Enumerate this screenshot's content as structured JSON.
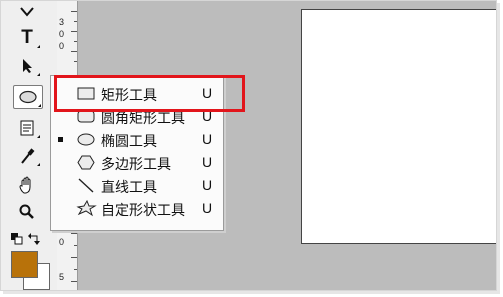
{
  "toolbox": {
    "text_tool_glyph": "T",
    "foreground_color": "#b8720a",
    "background_color": "#ffffff"
  },
  "ruler": {
    "marks_top": [
      "3",
      "0",
      "0"
    ],
    "marks_bottom": [
      "0",
      "5"
    ]
  },
  "shape_menu": {
    "items": [
      {
        "label": "矩形工具",
        "shortcut": "U",
        "icon": "rectangle-icon",
        "selected": false
      },
      {
        "label": "圆角矩形工具",
        "shortcut": "U",
        "icon": "rounded-rectangle-icon",
        "selected": false
      },
      {
        "label": "椭圆工具",
        "shortcut": "U",
        "icon": "ellipse-icon",
        "selected": true
      },
      {
        "label": "多边形工具",
        "shortcut": "U",
        "icon": "polygon-icon",
        "selected": false
      },
      {
        "label": "直线工具",
        "shortcut": "U",
        "icon": "line-icon",
        "selected": false
      },
      {
        "label": "自定形状工具",
        "shortcut": "U",
        "icon": "custom-shape-icon",
        "selected": false
      }
    ]
  },
  "highlight": {
    "color": "#e2151b",
    "target": "矩形工具"
  }
}
